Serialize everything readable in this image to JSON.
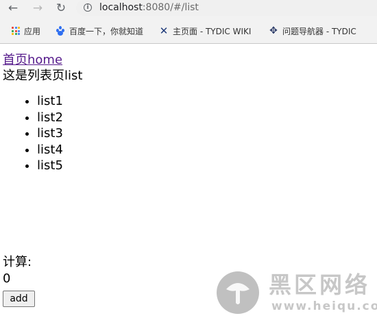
{
  "browser": {
    "url_host": "localhost",
    "url_path": ":8080/#/list",
    "bookmarks": [
      {
        "label": "应用",
        "icon": "apps-grid-icon"
      },
      {
        "label": "百度一下，你就知道",
        "icon": "baidu-paw-icon"
      },
      {
        "label": "主页面 - TYDIC WIKI",
        "icon": "wiki-x-icon"
      },
      {
        "label": "问题导航器 - TYDIC",
        "icon": "navigator-icon"
      }
    ],
    "nav_icons": [
      "back-arrow-icon",
      "forward-arrow-icon",
      "reload-icon",
      "info-icon"
    ]
  },
  "page": {
    "home_link": "首页home",
    "page_text": "这是列表页list",
    "list_items": [
      "list1",
      "list2",
      "list3",
      "list4",
      "list5"
    ],
    "calc_label": "计算:",
    "count": "0",
    "add_label": "add"
  },
  "watermark": {
    "title": "黑区网络",
    "url": "www.heiqu.com"
  },
  "colors": {
    "link_visited": "#551a8b",
    "chrome_bg": "#f2f2f2",
    "omnibox_bg": "#f0f0f0"
  }
}
